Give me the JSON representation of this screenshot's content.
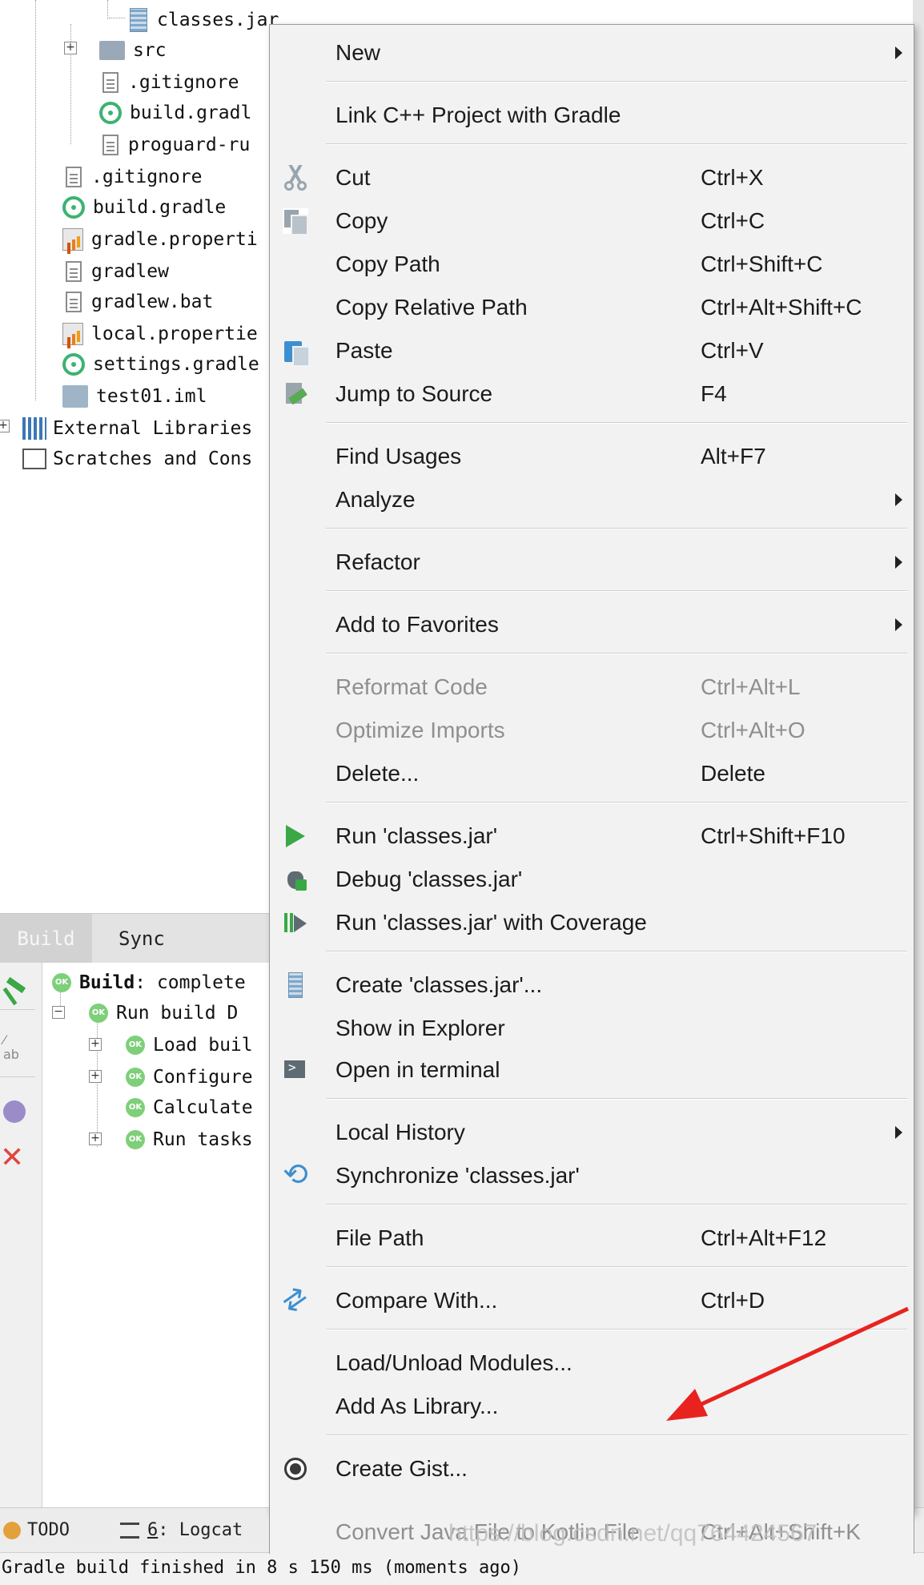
{
  "project_tree": {
    "items": [
      {
        "label": "classes.jar",
        "icon": "jar-icon"
      },
      {
        "label": "src",
        "icon": "folder-icon"
      },
      {
        "label": ".gitignore",
        "icon": "file-icon"
      },
      {
        "label": "build.gradl",
        "icon": "gradle-icon"
      },
      {
        "label": "proguard-ru",
        "icon": "file-icon"
      },
      {
        "label": ".gitignore",
        "icon": "file-icon"
      },
      {
        "label": "build.gradle",
        "icon": "gradle-icon"
      },
      {
        "label": "gradle.properti",
        "icon": "properties-icon"
      },
      {
        "label": "gradlew",
        "icon": "file-icon"
      },
      {
        "label": "gradlew.bat",
        "icon": "file-icon"
      },
      {
        "label": "local.propertie",
        "icon": "properties-icon"
      },
      {
        "label": "settings.gradle",
        "icon": "gradle-icon"
      },
      {
        "label": "test01.iml",
        "icon": "iml-icon"
      },
      {
        "label": "External Libraries",
        "icon": "library-icon"
      },
      {
        "label": "Scratches and Cons",
        "icon": "scratch-icon"
      }
    ]
  },
  "build_window": {
    "tabs": [
      "Build",
      "Sync"
    ],
    "tree": [
      {
        "bold": "Build",
        "rest": ": complete",
        "status": "OK"
      },
      {
        "bold": "",
        "rest": "Run build  D",
        "status": "OK"
      },
      {
        "bold": "",
        "rest": "Load buil",
        "status": "OK"
      },
      {
        "bold": "",
        "rest": "Configure",
        "status": "OK"
      },
      {
        "bold": "",
        "rest": "Calculate",
        "status": "OK"
      },
      {
        "bold": "",
        "rest": "Run tasks",
        "status": "OK"
      }
    ]
  },
  "bottom_tools": {
    "todo": "TODO",
    "logcat_num": "6",
    "logcat_label": ": Logcat"
  },
  "status_bar": {
    "text": "Gradle build finished in 8 s 150 ms (moments ago)"
  },
  "context_menu": {
    "items": [
      {
        "label": "New",
        "shortcut": "",
        "submenu": true
      },
      {
        "label": "Link C++ Project with Gradle",
        "shortcut": ""
      },
      {
        "label": "Cut",
        "shortcut": "Ctrl+X",
        "icon": "scissors-icon"
      },
      {
        "label": "Copy",
        "shortcut": "Ctrl+C",
        "icon": "copy-icon"
      },
      {
        "label": "Copy Path",
        "shortcut": "Ctrl+Shift+C"
      },
      {
        "label": "Copy Relative Path",
        "shortcut": "Ctrl+Alt+Shift+C"
      },
      {
        "label": "Paste",
        "shortcut": "Ctrl+V",
        "icon": "paste-icon"
      },
      {
        "label": "Jump to Source",
        "shortcut": "F4",
        "icon": "jump-to-source-icon"
      },
      {
        "label": "Find Usages",
        "shortcut": "Alt+F7"
      },
      {
        "label": "Analyze",
        "shortcut": "",
        "submenu": true
      },
      {
        "label": "Refactor",
        "shortcut": "",
        "submenu": true
      },
      {
        "label": "Add to Favorites",
        "shortcut": "",
        "submenu": true
      },
      {
        "label": "Reformat Code",
        "shortcut": "Ctrl+Alt+L",
        "disabled": true
      },
      {
        "label": "Optimize Imports",
        "shortcut": "Ctrl+Alt+O",
        "disabled": true
      },
      {
        "label": "Delete...",
        "shortcut": "Delete"
      },
      {
        "label": "Run 'classes.jar'",
        "shortcut": "Ctrl+Shift+F10",
        "icon": "run-icon"
      },
      {
        "label": "Debug 'classes.jar'",
        "shortcut": "",
        "icon": "debug-icon"
      },
      {
        "label": "Run 'classes.jar' with Coverage",
        "shortcut": "",
        "icon": "coverage-icon"
      },
      {
        "label": "Create 'classes.jar'...",
        "shortcut": "",
        "icon": "jar-icon"
      },
      {
        "label": "Show in Explorer",
        "shortcut": ""
      },
      {
        "label": "Open in terminal",
        "shortcut": "",
        "icon": "terminal-icon"
      },
      {
        "label": "Local History",
        "shortcut": "",
        "submenu": true
      },
      {
        "label": "Synchronize 'classes.jar'",
        "shortcut": "",
        "icon": "sync-icon"
      },
      {
        "label": "File Path",
        "shortcut": "Ctrl+Alt+F12"
      },
      {
        "label": "Compare With...",
        "shortcut": "Ctrl+D",
        "icon": "compare-icon"
      },
      {
        "label": "Load/Unload Modules...",
        "shortcut": ""
      },
      {
        "label": "Add As Library...",
        "shortcut": ""
      },
      {
        "label": "Create Gist...",
        "shortcut": "",
        "icon": "github-icon"
      },
      {
        "label": "Convert Java File to Kotlin File",
        "shortcut": "Ctrl+Alt+Shift+K",
        "disabled": true
      }
    ]
  },
  "watermark": "https://blog.csdn.net/qq764424567",
  "colors": {
    "menu_bg": "#f2f2f2",
    "disabled_text": "#8f8f8f",
    "run_green": "#39a845",
    "annotation_arrow": "#e8231f"
  }
}
